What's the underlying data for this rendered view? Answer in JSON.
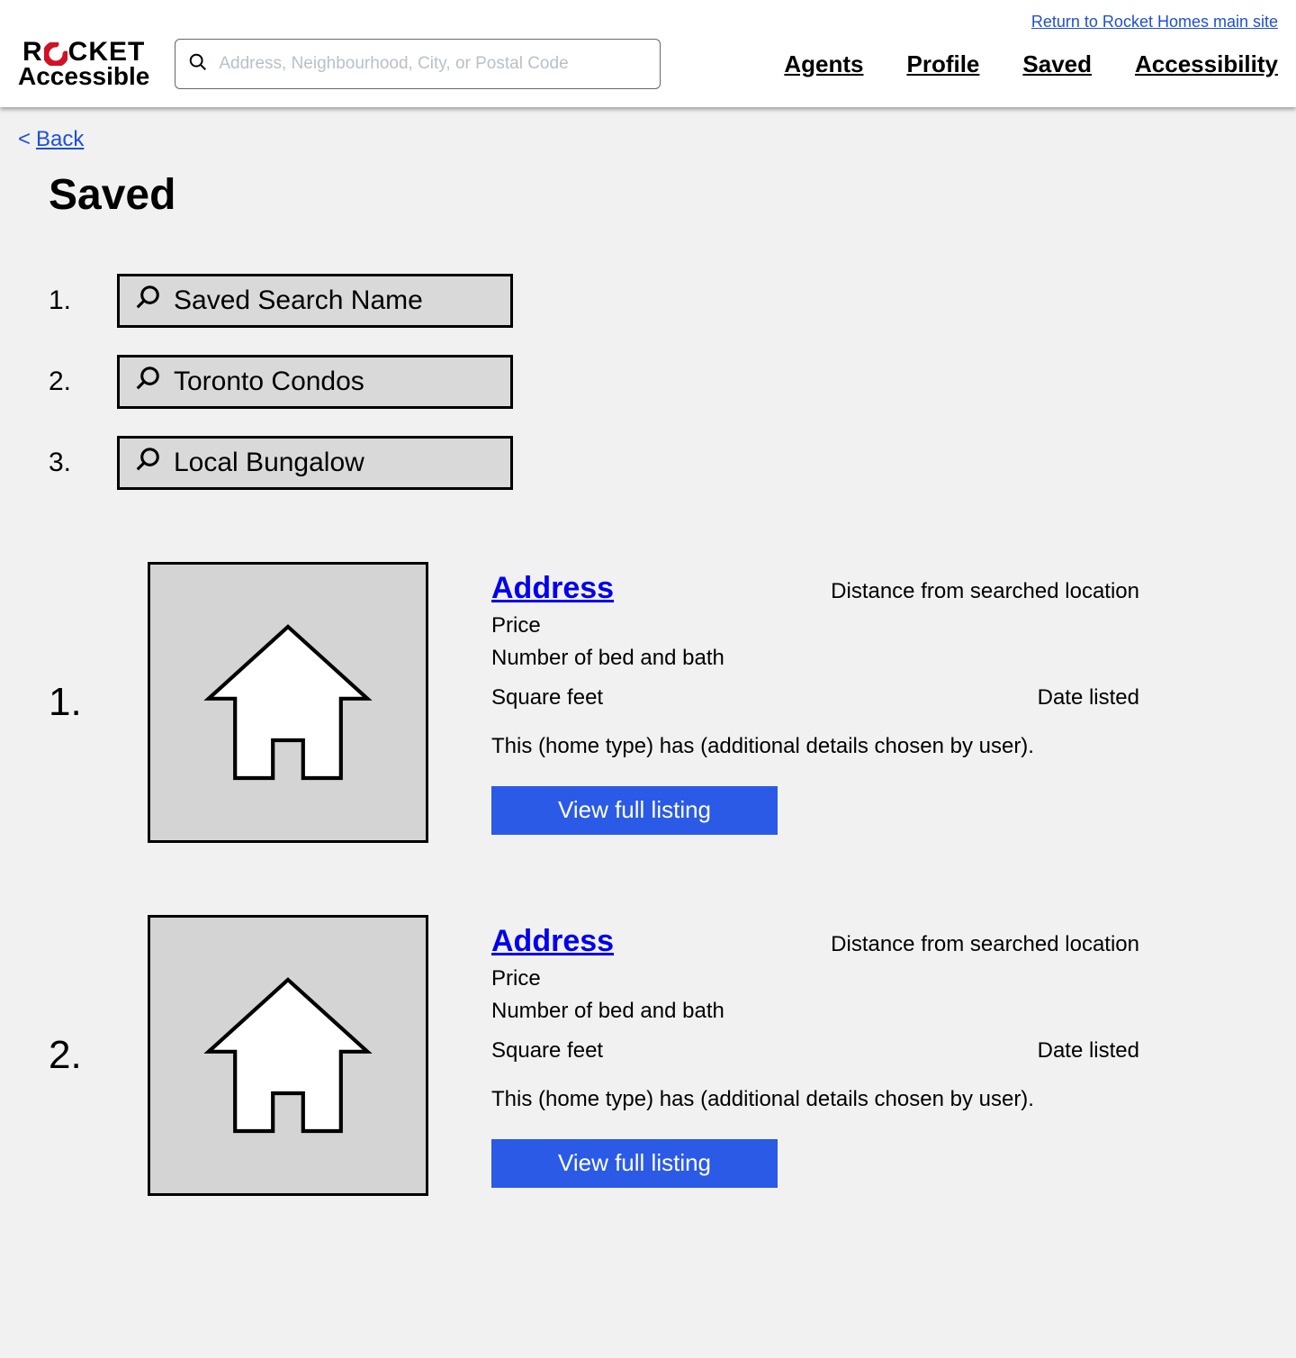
{
  "header": {
    "return_link": "Return to Rocket Homes main site",
    "logo_top_left": "R",
    "logo_top_right": "CKET",
    "logo_bottom": "Accessible",
    "search_placeholder": "Address, Neighbourhood, City, or Postal Code",
    "nav": {
      "agents": "Agents",
      "profile": "Profile",
      "saved": "Saved",
      "accessibility": "Accessibility"
    }
  },
  "back": {
    "lt": "<",
    "label": "Back"
  },
  "page_title": "Saved",
  "saved_searches": [
    {
      "num": "1.",
      "label": "Saved Search Name"
    },
    {
      "num": "2.",
      "label": "Toronto Condos"
    },
    {
      "num": "3.",
      "label": "Local Bungalow"
    }
  ],
  "listings": [
    {
      "num": "1.",
      "address": "Address",
      "distance": "Distance from searched location",
      "price": "Price",
      "bed_bath": "Number of bed and bath",
      "sqft": "Square feet",
      "date": "Date listed",
      "desc": "This (home type) has (additional details chosen by user).",
      "button": "View full listing"
    },
    {
      "num": "2.",
      "address": "Address",
      "distance": "Distance from searched location",
      "price": "Price",
      "bed_bath": "Number of bed and bath",
      "sqft": "Square feet",
      "date": "Date listed",
      "desc": "This (home type) has (additional details chosen by user).",
      "button": "View full listing"
    }
  ]
}
